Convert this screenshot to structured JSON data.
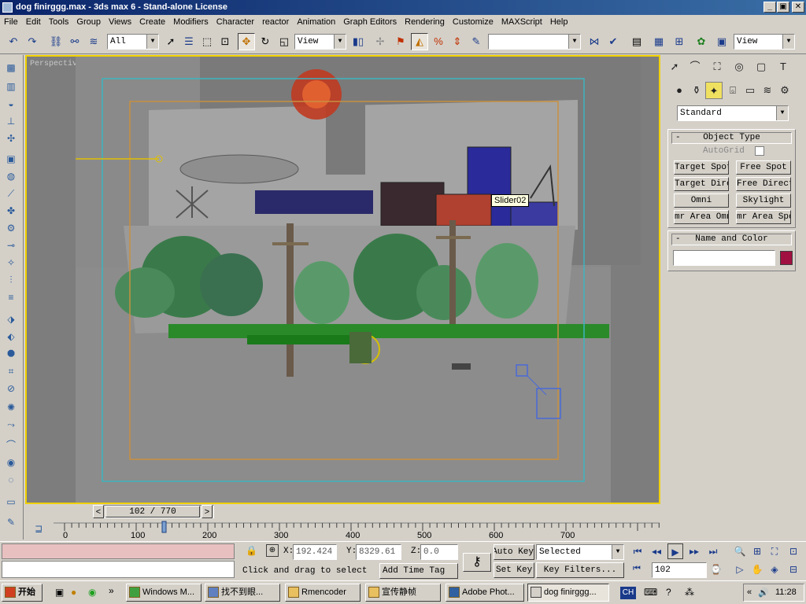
{
  "window": {
    "title": "dog finirggg.max - 3ds max 6 - Stand-alone License",
    "min": "_",
    "max": "▣",
    "close": "✕"
  },
  "menu": [
    "File",
    "Edit",
    "Tools",
    "Group",
    "Views",
    "Create",
    "Modifiers",
    "Character",
    "reactor",
    "Animation",
    "Graph Editors",
    "Rendering",
    "Customize",
    "MAXScript",
    "Help"
  ],
  "toolbar": {
    "selection_filter": "All",
    "ref_coord": "View",
    "named_selection": "",
    "view_right": "View"
  },
  "viewport": {
    "label": "Perspective",
    "tooltip": "Slider02"
  },
  "command_panel": {
    "category": "Standard",
    "object_type": {
      "title": "Object Type",
      "autogrid": "AutoGrid",
      "buttons": [
        "Target Spot",
        "Free Spot",
        "Target Direct",
        "Free Direct",
        "Omni",
        "Skylight",
        "mr Area Omni",
        "mr Area Spot"
      ]
    },
    "name_color": {
      "title": "Name and Color",
      "name_value": "",
      "swatch": "#a01040"
    }
  },
  "time_slider": {
    "label": "102 / 770",
    "prev": "<",
    "next": ">",
    "current": 102,
    "total": 770
  },
  "trackbar": {
    "ticks": [
      "0",
      "100",
      "200",
      "300",
      "400",
      "500",
      "600",
      "700"
    ]
  },
  "status": {
    "x_label": "X:",
    "x": "192.424",
    "y_label": "Y:",
    "y": "8329.61",
    "z_label": "Z:",
    "z": "0.0",
    "prompt": "Click and drag to select",
    "add_time_tag": "Add Time Tag",
    "auto_key": "Auto Key",
    "set_key": "Set Key",
    "key_mode": "Selected",
    "key_filters": "Key Filters...",
    "frame": "102"
  },
  "taskbar": {
    "start": "开始",
    "tasks": [
      "Windows M...",
      "找不到眼...",
      "Rmencoder",
      "宣传静帧",
      "Adobe Phot...",
      "dog finirggg..."
    ],
    "lang": "CH",
    "clock": "11:28"
  },
  "colors": {
    "viewport_border": "#f0d000",
    "safe_frame": "#3cb4c0",
    "render_frame": "#c89040"
  }
}
